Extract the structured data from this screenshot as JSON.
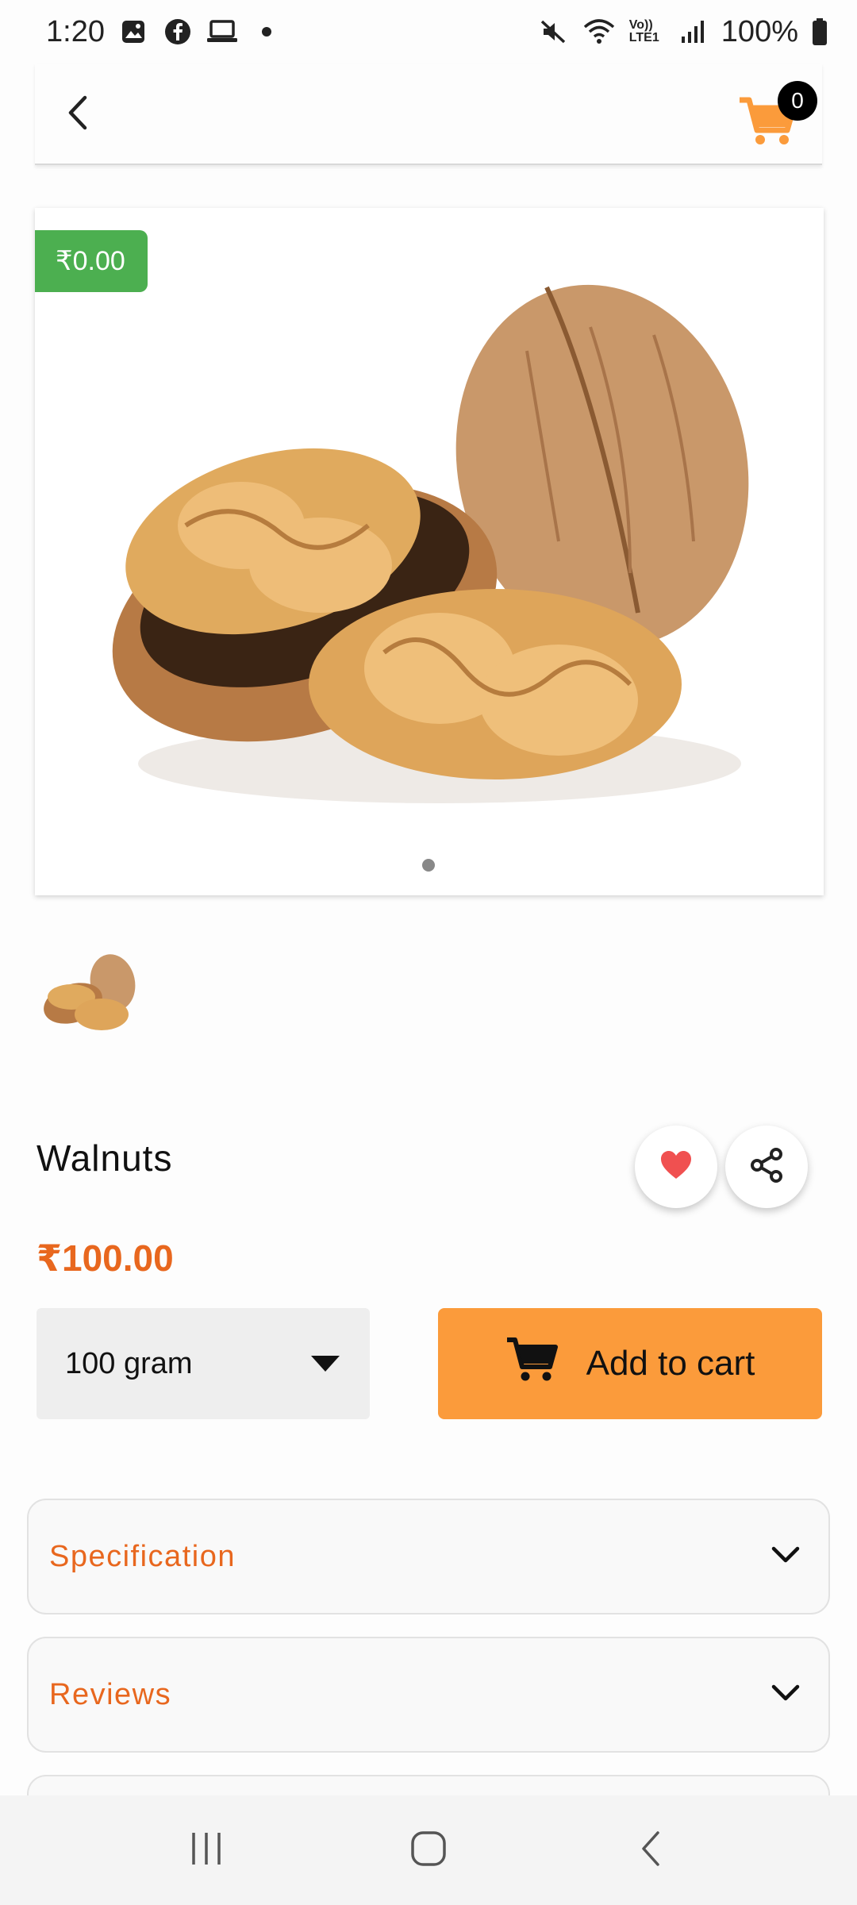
{
  "status_bar": {
    "time": "1:20",
    "battery": "100%",
    "network": "Vo)) LTE1"
  },
  "app_bar": {
    "cart_count": "0"
  },
  "product": {
    "image_price_tag": "₹0.00",
    "title": "Walnuts",
    "price": "₹100.00",
    "quantity_selected": "100 gram",
    "add_to_cart_label": "Add to cart"
  },
  "accordions": {
    "specification_label": "Specification",
    "reviews_label": "Reviews"
  },
  "colors": {
    "accent_orange": "#fb9b3b",
    "price_orange": "#e8671e",
    "badge_green": "#4caf50",
    "heart_red": "#f05050"
  },
  "icons": [
    "back-icon",
    "cart-icon",
    "heart-icon",
    "share-icon",
    "dropdown-arrow-icon",
    "chevron-down-icon",
    "recents-icon",
    "home-icon",
    "nav-back-icon"
  ]
}
